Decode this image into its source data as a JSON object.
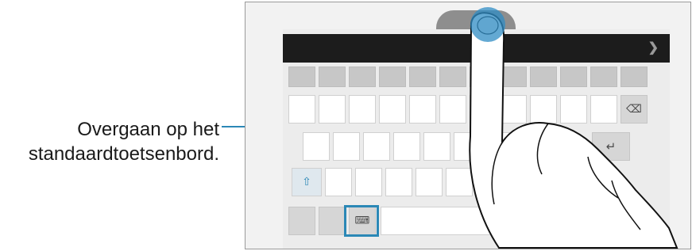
{
  "callout": {
    "line1": "Overgaan op het",
    "line2": "standaardtoetsenbord."
  },
  "keyboard": {
    "chevron_icon": "chevron-right-icon",
    "keys": {
      "backspace_icon": "backspace-icon",
      "enter_icon": "enter-icon",
      "shift_icon": "shift-icon",
      "keyboard_switch_icon": "keyboard-switch-icon",
      "space_icon": "space-icon"
    }
  },
  "colors": {
    "accent": "#2b88b6",
    "touch_dot": "#2f8cc4",
    "topbar": "#1c1c1c"
  }
}
